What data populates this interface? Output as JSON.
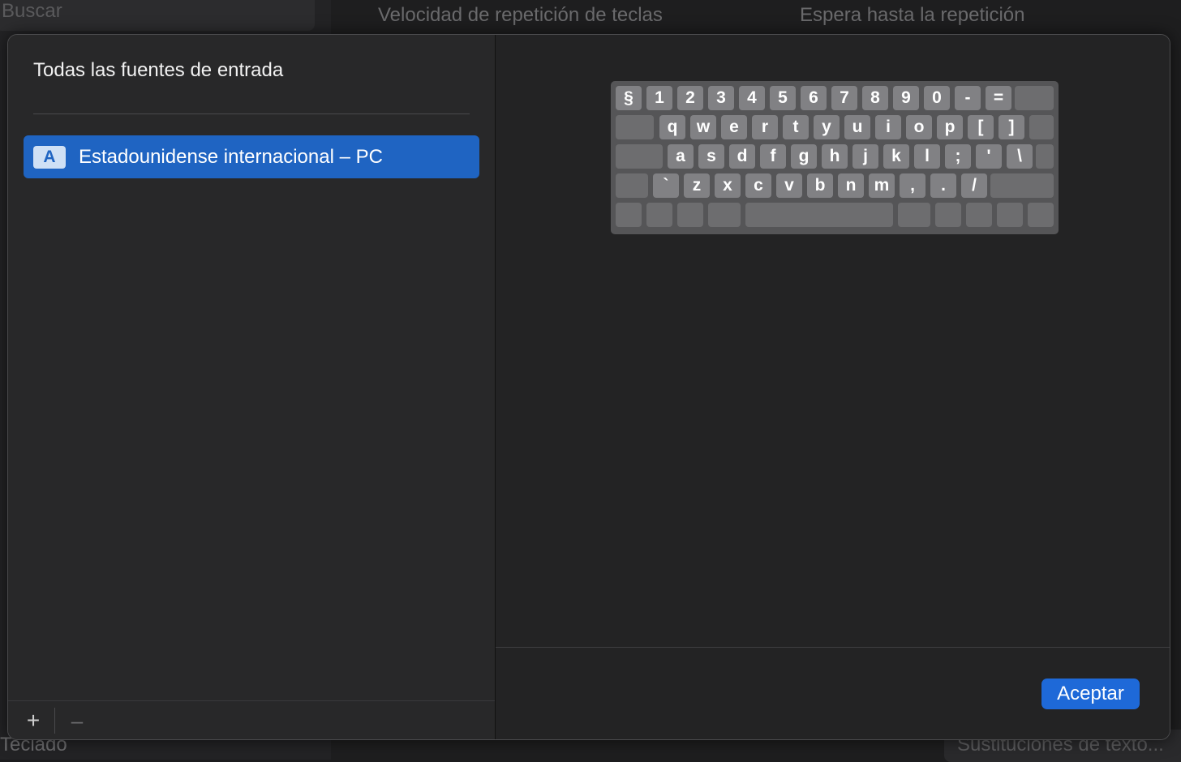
{
  "background": {
    "search_placeholder": "Buscar",
    "key_repeat_rate_label": "Velocidad de repetición de teclas",
    "delay_until_repeat_label": "Espera hasta la repetición",
    "sidebar_bottom_label": "Teclado",
    "text_replacements_button": "Sustituciones de texto..."
  },
  "sheet": {
    "list_title": "Todas las fuentes de entrada",
    "sources": [
      {
        "badge": "A",
        "label": "Estadounidense internacional – PC",
        "selected": true
      }
    ],
    "add_button": "+",
    "remove_button": "–",
    "ok_button": "Aceptar"
  },
  "keyboard": {
    "rows": [
      [
        "§",
        "1",
        "2",
        "3",
        "4",
        "5",
        "6",
        "7",
        "8",
        "9",
        "0",
        "-",
        "="
      ],
      [
        "q",
        "w",
        "e",
        "r",
        "t",
        "y",
        "u",
        "i",
        "o",
        "p",
        "[",
        "]"
      ],
      [
        "a",
        "s",
        "d",
        "f",
        "g",
        "h",
        "j",
        "k",
        "l",
        ";",
        "'",
        "\\"
      ],
      [
        "`",
        "z",
        "x",
        "c",
        "v",
        "b",
        "n",
        "m",
        ",",
        ".",
        "/"
      ]
    ]
  },
  "colors": {
    "accent": "#1e69d8",
    "selection": "#1f64c2",
    "key": "#818184",
    "keyboard_bg": "#555557"
  }
}
